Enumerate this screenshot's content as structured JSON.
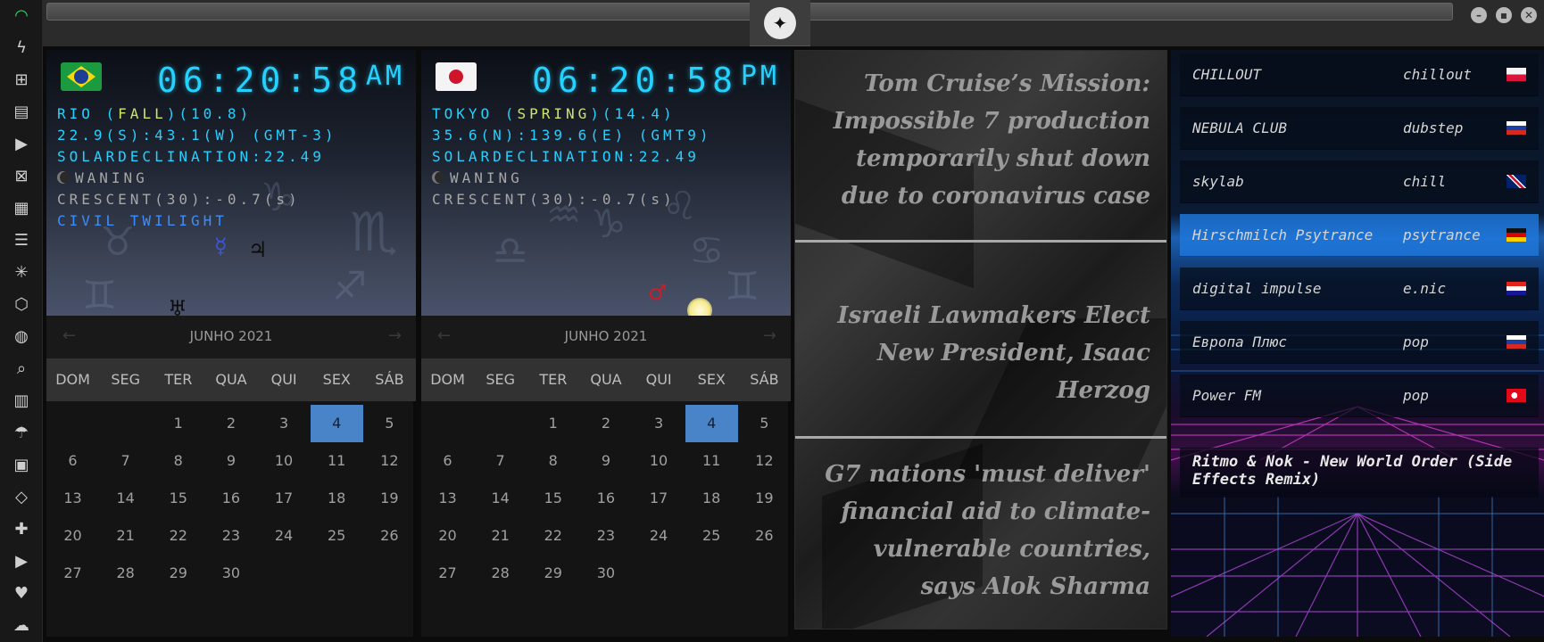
{
  "window": {
    "minimize_glyph": "–",
    "maximize_glyph": "▪",
    "close_glyph": "✕",
    "brand_glyph": "✦"
  },
  "rail": {
    "icons": [
      {
        "name": "wifi-icon",
        "glyph": "◠"
      },
      {
        "name": "lightning-icon",
        "glyph": "ϟ"
      },
      {
        "name": "windows-icon",
        "glyph": "⊞"
      },
      {
        "name": "archive-icon",
        "glyph": "▤"
      },
      {
        "name": "play-icon",
        "glyph": "▶"
      },
      {
        "name": "map-icon",
        "glyph": "⊠"
      },
      {
        "name": "image-icon",
        "glyph": "▦"
      },
      {
        "name": "news-icon",
        "glyph": "☰"
      },
      {
        "name": "asterisk-icon",
        "glyph": "✳"
      },
      {
        "name": "hexagon-icon",
        "glyph": "⬡"
      },
      {
        "name": "globe-icon",
        "glyph": "◍"
      },
      {
        "name": "search-icon",
        "glyph": "⌕"
      },
      {
        "name": "folded-map-icon",
        "glyph": "▥"
      },
      {
        "name": "umbrella-icon",
        "glyph": "☂"
      },
      {
        "name": "contact-icon",
        "glyph": "▣"
      },
      {
        "name": "code-icon",
        "glyph": "◇"
      },
      {
        "name": "expand-icon",
        "glyph": "✚"
      },
      {
        "name": "youtube-icon",
        "glyph": "▶"
      },
      {
        "name": "heart-icon",
        "glyph": "♥"
      },
      {
        "name": "cloud-icon",
        "glyph": "☁"
      }
    ]
  },
  "clocks": [
    {
      "time": "06:20:58",
      "ampm": "AM",
      "line1_pre": "RIO (",
      "line1_hl": "FALL",
      "line1_post": ")(10.8)",
      "line2": "22.9(S):43.1(W) (GMT-3)",
      "line3": "SOLARDECLINATION:22.49",
      "line4": "WANING",
      "line5": "CRESCENT(30):-0.7(s)",
      "line6": "CIVIL TWILIGHT",
      "mercury_glyph": "☿",
      "jupiter_glyph": "♃",
      "uranus_glyph": "♅"
    },
    {
      "time": "06:20:58",
      "ampm": "PM",
      "line1_pre": "TOKYO (",
      "line1_hl": "SPRING",
      "line1_post": ")(14.4)",
      "line2": "35.6(N):139.6(E) (GMT9)",
      "line3": "SOLARDECLINATION:22.49",
      "line4": "WANING",
      "line5": "CRESCENT(30):-0.7(s)",
      "mars_glyph": "♂"
    }
  ],
  "calendar": {
    "month_title": "JUNHO 2021",
    "prev_glyph": "←",
    "next_glyph": "→",
    "weekdays": [
      "DOM",
      "SEG",
      "TER",
      "QUA",
      "QUI",
      "SEX",
      "SÁB"
    ],
    "first_weekday_index": 2,
    "days_in_month": 30,
    "today": 4
  },
  "news": [
    "Tom Cruise’s Mission: Impossible 7 production temporarily shut down due to coronavirus case",
    "Israeli Lawmakers Elect New President, Isaac Herzog",
    "G7 nations 'must deliver' financial aid to climate-vulnerable countries, says Alok Sharma"
  ],
  "radio": {
    "stations": [
      {
        "name": "CHILLOUT",
        "genre": "chillout",
        "flag": "pl"
      },
      {
        "name": "NEBULA CLUB",
        "genre": "dubstep",
        "flag": "ru"
      },
      {
        "name": "skylab",
        "genre": "chill",
        "flag": "gb"
      },
      {
        "name": "Hirschmilch Psytrance",
        "genre": "psytrance",
        "flag": "de"
      },
      {
        "name": "digital impulse",
        "genre": "e.nic",
        "flag": "hr"
      },
      {
        "name": "Европа Плюс",
        "genre": "pop",
        "flag": "ru"
      },
      {
        "name": "Power FM",
        "genre": "pop",
        "flag": "tr"
      }
    ],
    "active_index": 3,
    "now_playing": "Ritmo & Nok - New World Order (Side Effects Remix)"
  }
}
